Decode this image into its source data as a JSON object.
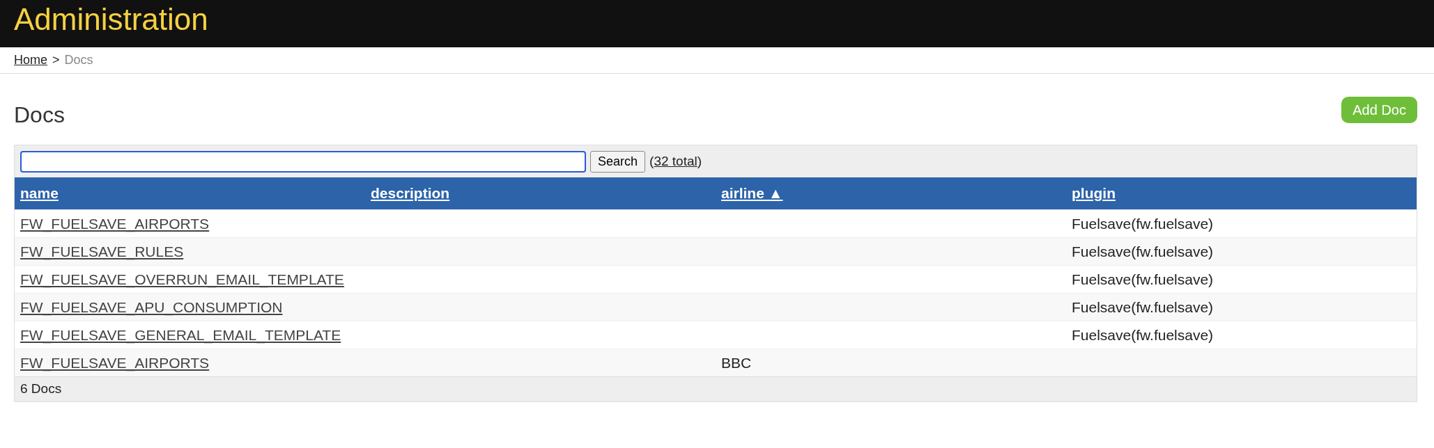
{
  "header": {
    "title": "Administration"
  },
  "breadcrumb": [
    {
      "label": "Home",
      "current": false
    },
    {
      "label": ">",
      "kind": "separator"
    },
    {
      "label": "Docs",
      "current": true
    }
  ],
  "page_title": "Docs",
  "add_button": "Add Doc",
  "search": {
    "focused": true,
    "button": "Search",
    "total_before": "(",
    "total_link": "32 total",
    "total_after": ")"
  },
  "table": {
    "columns": [
      {
        "label": "name"
      },
      {
        "label": "description"
      },
      {
        "label": "airline",
        "sort_indicator": "▲"
      },
      {
        "label": "plugin"
      }
    ],
    "rows": [
      {
        "name": "FW_FUELSAVE_AIRPORTS",
        "airline": "",
        "plugin": "Fuelsave(fw.fuelsave)"
      },
      {
        "name": "FW_FUELSAVE_RULES",
        "airline": "",
        "plugin": "Fuelsave(fw.fuelsave)"
      },
      {
        "name": "FW_FUELSAVE_OVERRUN_EMAIL_TEMPLATE",
        "airline": "",
        "plugin": "Fuelsave(fw.fuelsave)"
      },
      {
        "name": "FW_FUELSAVE_APU_CONSUMPTION",
        "airline": "",
        "plugin": "Fuelsave(fw.fuelsave)"
      },
      {
        "name": "FW_FUELSAVE_GENERAL_EMAIL_TEMPLATE",
        "airline": "",
        "plugin": "Fuelsave(fw.fuelsave)"
      },
      {
        "name": "FW_FUELSAVE_AIRPORTS",
        "airline": "BBC",
        "plugin": ""
      }
    ],
    "footer": "6 Docs"
  }
}
